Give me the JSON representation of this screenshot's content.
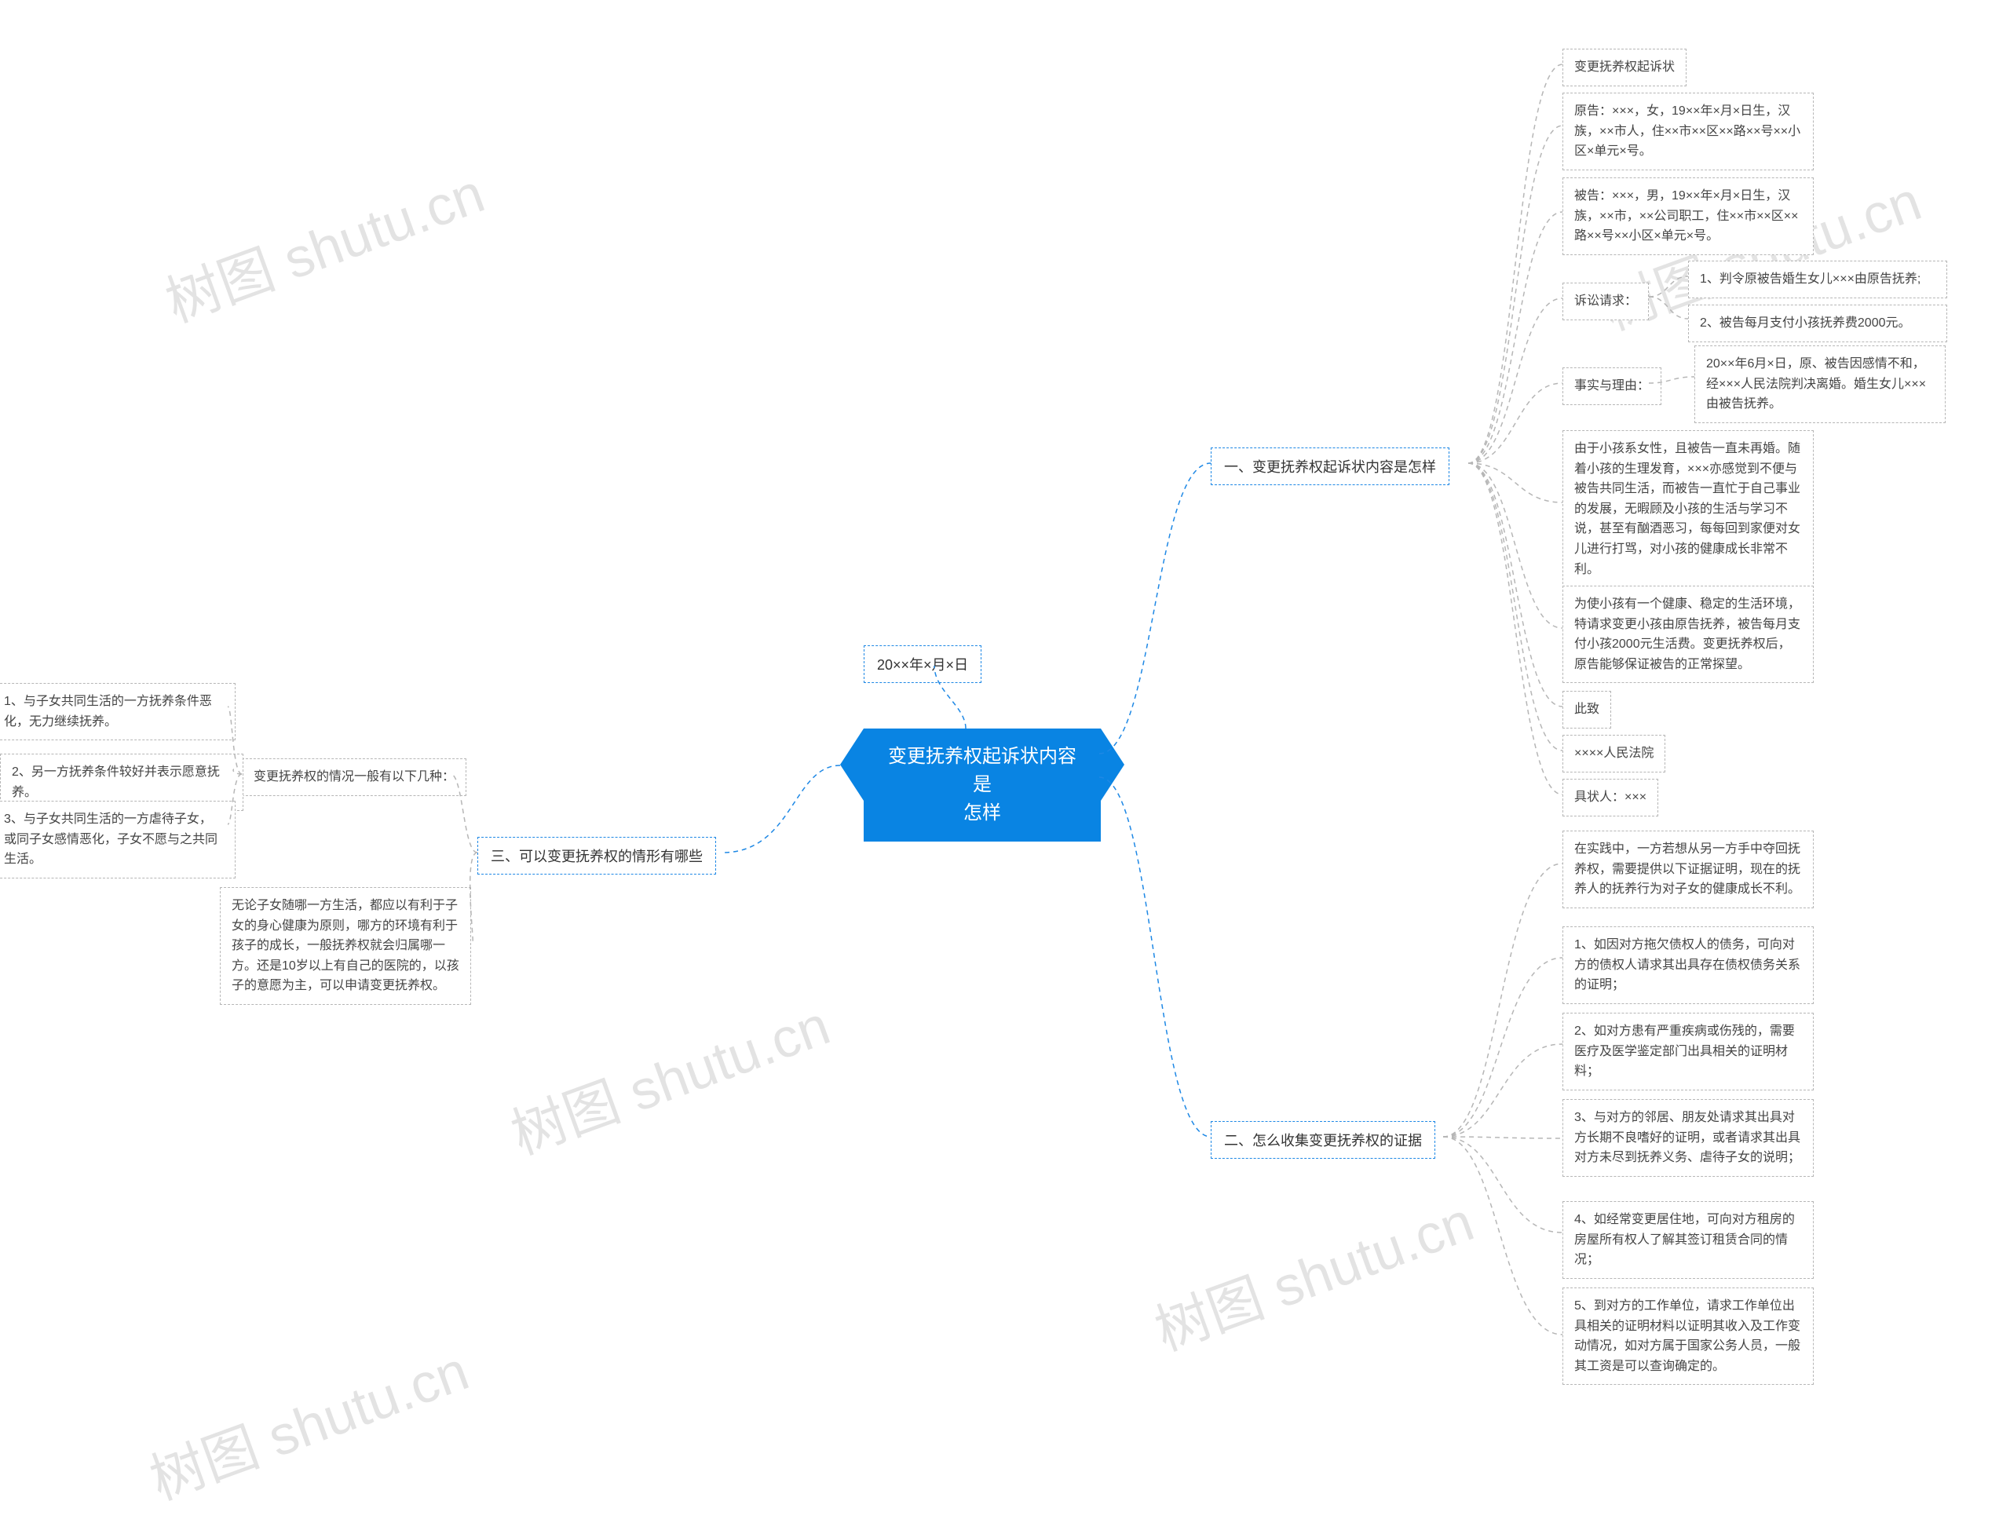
{
  "watermark": "树图 shutu.cn",
  "center": "变更抚养权起诉状内容是\n怎样",
  "branches": {
    "date": "20××年×月×日",
    "s1": "一、变更抚养权起诉状内容是怎样",
    "s2": "二、怎么收集变更抚养权的证据",
    "s3": "三、可以变更抚养权的情形有哪些",
    "s3sub": "变更抚养权的情况一般有以下几种："
  },
  "s1_leaves": {
    "a": "变更抚养权起诉状",
    "b": "原告：×××，女，19××年×月×日生，汉族，××市人，住××市××区××路××号××小区×单元×号。",
    "c": "被告：×××，男，19××年×月×日生，汉族，××市，××公司职工，住××市××区××路××号××小区×单元×号。",
    "d": "诉讼请求：",
    "d1": "1、判令原被告婚生女儿×××由原告抚养;",
    "d2": "2、被告每月支付小孩抚养费2000元。",
    "e": "事实与理由：",
    "e1": "20××年6月×日，原、被告因感情不和，经×××人民法院判决离婚。婚生女儿×××由被告抚养。",
    "f": "由于小孩系女性，且被告一直未再婚。随着小孩的生理发育，×××亦感觉到不便与被告共同生活，而被告一直忙于自己事业的发展，无暇顾及小孩的生活与学习不说，甚至有酗酒恶习，每每回到家便对女儿进行打骂，对小孩的健康成长非常不利。",
    "g": "为使小孩有一个健康、稳定的生活环境，特请求变更小孩由原告抚养，被告每月支付小孩2000元生活费。变更抚养权后，原告能够保证被告的正常探望。",
    "h": "此致",
    "i": "××××人民法院",
    "j": "具状人：×××"
  },
  "s2_leaves": {
    "intro": "在实践中，一方若想从另一方手中夺回抚养权，需要提供以下证据证明，现在的抚养人的抚养行为对子女的健康成长不利。",
    "p1": "1、如因对方拖欠债权人的债务，可向对方的债权人请求其出具存在债权债务关系的证明；",
    "p2": "2、如对方患有严重疾病或伤残的，需要医疗及医学鉴定部门出具相关的证明材料；",
    "p3": "3、与对方的邻居、朋友处请求其出具对方长期不良嗜好的证明，或者请求其出具对方未尽到抚养义务、虐待子女的说明；",
    "p4": "4、如经常变更居住地，可向对方租房的房屋所有权人了解其签订租赁合同的情况；",
    "p5": "5、到对方的工作单位，请求工作单位出具相关的证明材料以证明其收入及工作变动情况，如对方属于国家公务人员，一般其工资是可以查询确定的。"
  },
  "s3_leaves": {
    "p1": "1、与子女共同生活的一方抚养条件恶化，无力继续抚养。",
    "p2": "2、另一方抚养条件较好并表示愿意抚养。",
    "p3": "3、与子女共同生活的一方虐待子女，或同子女感情恶化，子女不愿与之共同生活。",
    "note": "无论子女随哪一方生活，都应以有利于子女的身心健康为原则，哪方的环境有利于孩子的成长，一般抚养权就会归属哪一方。还是10岁以上有自己的医院的，以孩子的意愿为主，可以申请变更抚养权。"
  }
}
